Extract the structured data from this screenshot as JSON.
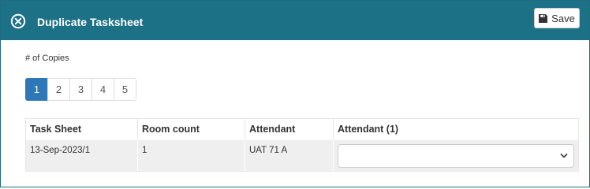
{
  "dialog": {
    "title": "Duplicate Tasksheet",
    "save_label": "Save"
  },
  "copies": {
    "label": "# of Copies",
    "pages": [
      "1",
      "2",
      "3",
      "4",
      "5"
    ],
    "selected": "1"
  },
  "table": {
    "headers": [
      "Task Sheet",
      "Room count",
      "Attendant",
      "Attendant (1)"
    ],
    "rows": [
      {
        "task_sheet": "13-Sep-2023/1",
        "room_count": "1",
        "attendant": "UAT 71 A",
        "attendant_1": ""
      }
    ]
  },
  "colors": {
    "header_bg": "#1d7186",
    "active_page": "#2f78b7",
    "row_bg": "#efefef"
  },
  "icons": {
    "close": "close-circle-icon",
    "save": "floppy-disk-icon",
    "select": "chevron-down-icon"
  }
}
